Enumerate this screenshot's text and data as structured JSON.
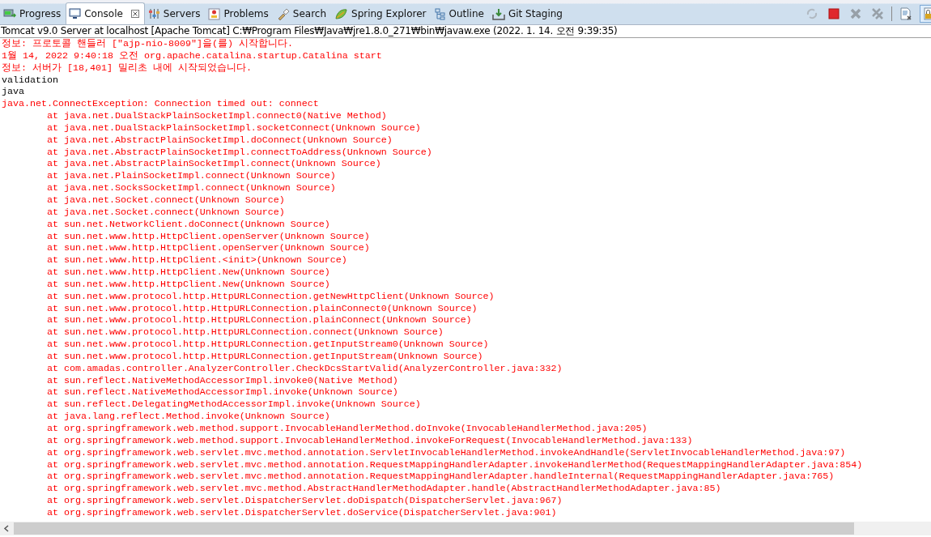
{
  "tabs": [
    {
      "label": "Progress",
      "kind": "progress",
      "selected": false,
      "closable": false
    },
    {
      "label": "Console",
      "kind": "console",
      "selected": true,
      "closable": true
    },
    {
      "label": "Servers",
      "kind": "servers",
      "selected": false,
      "closable": false
    },
    {
      "label": "Problems",
      "kind": "problems",
      "selected": false,
      "closable": false
    },
    {
      "label": "Search",
      "kind": "search",
      "selected": false,
      "closable": false
    },
    {
      "label": "Spring Explorer",
      "kind": "spring",
      "selected": false,
      "closable": false
    },
    {
      "label": "Outline",
      "kind": "outline",
      "selected": false,
      "closable": false
    },
    {
      "label": "Git Staging",
      "kind": "git",
      "selected": false,
      "closable": false
    }
  ],
  "toolbar": [
    {
      "kind": "sync",
      "disabled": true,
      "on": false
    },
    {
      "kind": "stop",
      "disabled": false,
      "on": false
    },
    {
      "kind": "remove",
      "disabled": true,
      "on": false
    },
    {
      "kind": "remove-all",
      "disabled": true,
      "on": false
    },
    {
      "kind": "clear",
      "disabled": false,
      "on": false
    },
    {
      "kind": "lock",
      "disabled": false,
      "on": true
    }
  ],
  "process_label": "Tomcat v9.0 Server at localhost [Apache Tomcat] C:₩Program Files₩Java₩jre1.8.0_271₩bin₩javaw.exe (2022. 1. 14. 오전 9:39:35)",
  "lines": [
    {
      "kind": "err",
      "text": "정보: 프로토콜 핸들러 [\"ajp-nio-8009\"]을(를) 시작합니다."
    },
    {
      "kind": "err",
      "text": "1월 14, 2022 9:40:18 오전 org.apache.catalina.startup.Catalina start"
    },
    {
      "kind": "err",
      "text": "정보: 서버가 [18,401] 밀리초 내에 시작되었습니다."
    },
    {
      "kind": "out",
      "text": "validation"
    },
    {
      "kind": "out",
      "text": "java"
    },
    {
      "kind": "err",
      "text": "java.net.ConnectException: Connection timed out: connect"
    },
    {
      "kind": "trace",
      "text": "at java.net.DualStackPlainSocketImpl.connect0(Native Method)"
    },
    {
      "kind": "trace",
      "text": "at java.net.DualStackPlainSocketImpl.socketConnect(Unknown Source)"
    },
    {
      "kind": "trace",
      "text": "at java.net.AbstractPlainSocketImpl.doConnect(Unknown Source)"
    },
    {
      "kind": "trace",
      "text": "at java.net.AbstractPlainSocketImpl.connectToAddress(Unknown Source)"
    },
    {
      "kind": "trace",
      "text": "at java.net.AbstractPlainSocketImpl.connect(Unknown Source)"
    },
    {
      "kind": "trace",
      "text": "at java.net.PlainSocketImpl.connect(Unknown Source)"
    },
    {
      "kind": "trace",
      "text": "at java.net.SocksSocketImpl.connect(Unknown Source)"
    },
    {
      "kind": "trace",
      "text": "at java.net.Socket.connect(Unknown Source)"
    },
    {
      "kind": "trace",
      "text": "at java.net.Socket.connect(Unknown Source)"
    },
    {
      "kind": "trace",
      "text": "at sun.net.NetworkClient.doConnect(Unknown Source)"
    },
    {
      "kind": "trace",
      "text": "at sun.net.www.http.HttpClient.openServer(Unknown Source)"
    },
    {
      "kind": "trace",
      "text": "at sun.net.www.http.HttpClient.openServer(Unknown Source)"
    },
    {
      "kind": "trace",
      "text": "at sun.net.www.http.HttpClient.<init>(Unknown Source)"
    },
    {
      "kind": "trace",
      "text": "at sun.net.www.http.HttpClient.New(Unknown Source)"
    },
    {
      "kind": "trace",
      "text": "at sun.net.www.http.HttpClient.New(Unknown Source)"
    },
    {
      "kind": "trace",
      "text": "at sun.net.www.protocol.http.HttpURLConnection.getNewHttpClient(Unknown Source)"
    },
    {
      "kind": "trace",
      "text": "at sun.net.www.protocol.http.HttpURLConnection.plainConnect0(Unknown Source)"
    },
    {
      "kind": "trace",
      "text": "at sun.net.www.protocol.http.HttpURLConnection.plainConnect(Unknown Source)"
    },
    {
      "kind": "trace",
      "text": "at sun.net.www.protocol.http.HttpURLConnection.connect(Unknown Source)"
    },
    {
      "kind": "trace",
      "text": "at sun.net.www.protocol.http.HttpURLConnection.getInputStream0(Unknown Source)"
    },
    {
      "kind": "trace",
      "text": "at sun.net.www.protocol.http.HttpURLConnection.getInputStream(Unknown Source)"
    },
    {
      "kind": "trace",
      "text": "at com.amadas.controller.AnalyzerController.CheckDcsStartValid(AnalyzerController.java:332)"
    },
    {
      "kind": "trace",
      "text": "at sun.reflect.NativeMethodAccessorImpl.invoke0(Native Method)"
    },
    {
      "kind": "trace",
      "text": "at sun.reflect.NativeMethodAccessorImpl.invoke(Unknown Source)"
    },
    {
      "kind": "trace",
      "text": "at sun.reflect.DelegatingMethodAccessorImpl.invoke(Unknown Source)"
    },
    {
      "kind": "trace",
      "text": "at java.lang.reflect.Method.invoke(Unknown Source)"
    },
    {
      "kind": "trace",
      "text": "at org.springframework.web.method.support.InvocableHandlerMethod.doInvoke(InvocableHandlerMethod.java:205)"
    },
    {
      "kind": "trace",
      "text": "at org.springframework.web.method.support.InvocableHandlerMethod.invokeForRequest(InvocableHandlerMethod.java:133)"
    },
    {
      "kind": "trace",
      "text": "at org.springframework.web.servlet.mvc.method.annotation.ServletInvocableHandlerMethod.invokeAndHandle(ServletInvocableHandlerMethod.java:97)"
    },
    {
      "kind": "trace",
      "text": "at org.springframework.web.servlet.mvc.method.annotation.RequestMappingHandlerAdapter.invokeHandlerMethod(RequestMappingHandlerAdapter.java:854)"
    },
    {
      "kind": "trace",
      "text": "at org.springframework.web.servlet.mvc.method.annotation.RequestMappingHandlerAdapter.handleInternal(RequestMappingHandlerAdapter.java:765)"
    },
    {
      "kind": "trace",
      "text": "at org.springframework.web.servlet.mvc.method.AbstractHandlerMethodAdapter.handle(AbstractHandlerMethodAdapter.java:85)"
    },
    {
      "kind": "trace",
      "text": "at org.springframework.web.servlet.DispatcherServlet.doDispatch(DispatcherServlet.java:967)"
    },
    {
      "kind": "trace",
      "text": "at org.springframework.web.servlet.DispatcherServlet.doService(DispatcherServlet.java:901)"
    }
  ]
}
